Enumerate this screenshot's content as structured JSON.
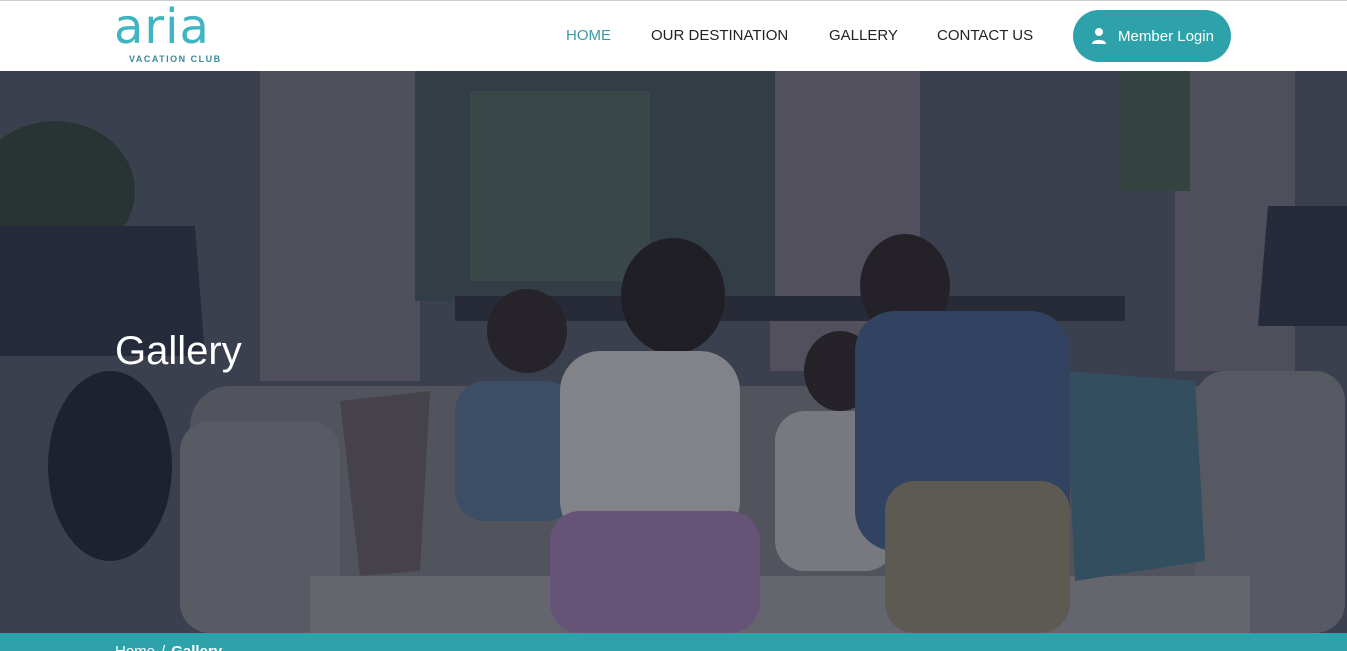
{
  "brand": {
    "name": "aria",
    "tagline": "VACATION CLUB",
    "accent_color": "#3fb5c4",
    "button_color": "#2ea2ab"
  },
  "nav": {
    "items": [
      {
        "label": "HOME",
        "active": true
      },
      {
        "label": "OUR DESTINATION",
        "active": false
      },
      {
        "label": "GALLERY",
        "active": false
      },
      {
        "label": "CONTACT US",
        "active": false
      }
    ],
    "login_label": "Member Login",
    "login_icon": "user-icon"
  },
  "hero": {
    "title": "Gallery",
    "image_description": "family-on-sofa-photo"
  },
  "breadcrumb": {
    "home": "Home",
    "separator": "/",
    "current": "Gallery"
  }
}
